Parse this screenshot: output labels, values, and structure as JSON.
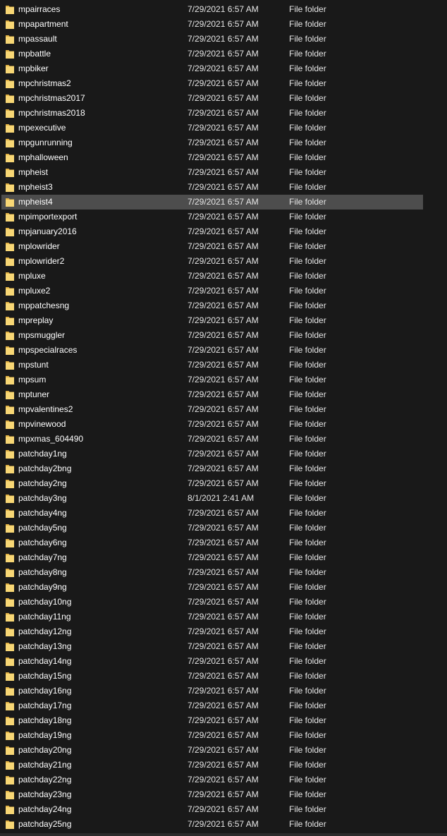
{
  "colors": {
    "background": "#191919",
    "selected_row": "#4d4d4d",
    "folder_icon": "#f8d775"
  },
  "icons": {
    "folder": "folder-icon"
  },
  "selected_index": 13,
  "rows": [
    {
      "name": "mpairraces",
      "date": "7/29/2021 6:57 AM",
      "type": "File folder"
    },
    {
      "name": "mpapartment",
      "date": "7/29/2021 6:57 AM",
      "type": "File folder"
    },
    {
      "name": "mpassault",
      "date": "7/29/2021 6:57 AM",
      "type": "File folder"
    },
    {
      "name": "mpbattle",
      "date": "7/29/2021 6:57 AM",
      "type": "File folder"
    },
    {
      "name": "mpbiker",
      "date": "7/29/2021 6:57 AM",
      "type": "File folder"
    },
    {
      "name": "mpchristmas2",
      "date": "7/29/2021 6:57 AM",
      "type": "File folder"
    },
    {
      "name": "mpchristmas2017",
      "date": "7/29/2021 6:57 AM",
      "type": "File folder"
    },
    {
      "name": "mpchristmas2018",
      "date": "7/29/2021 6:57 AM",
      "type": "File folder"
    },
    {
      "name": "mpexecutive",
      "date": "7/29/2021 6:57 AM",
      "type": "File folder"
    },
    {
      "name": "mpgunrunning",
      "date": "7/29/2021 6:57 AM",
      "type": "File folder"
    },
    {
      "name": "mphalloween",
      "date": "7/29/2021 6:57 AM",
      "type": "File folder"
    },
    {
      "name": "mpheist",
      "date": "7/29/2021 6:57 AM",
      "type": "File folder"
    },
    {
      "name": "mpheist3",
      "date": "7/29/2021 6:57 AM",
      "type": "File folder"
    },
    {
      "name": "mpheist4",
      "date": "7/29/2021 6:57 AM",
      "type": "File folder"
    },
    {
      "name": "mpimportexport",
      "date": "7/29/2021 6:57 AM",
      "type": "File folder"
    },
    {
      "name": "mpjanuary2016",
      "date": "7/29/2021 6:57 AM",
      "type": "File folder"
    },
    {
      "name": "mplowrider",
      "date": "7/29/2021 6:57 AM",
      "type": "File folder"
    },
    {
      "name": "mplowrider2",
      "date": "7/29/2021 6:57 AM",
      "type": "File folder"
    },
    {
      "name": "mpluxe",
      "date": "7/29/2021 6:57 AM",
      "type": "File folder"
    },
    {
      "name": "mpluxe2",
      "date": "7/29/2021 6:57 AM",
      "type": "File folder"
    },
    {
      "name": "mppatchesng",
      "date": "7/29/2021 6:57 AM",
      "type": "File folder"
    },
    {
      "name": "mpreplay",
      "date": "7/29/2021 6:57 AM",
      "type": "File folder"
    },
    {
      "name": "mpsmuggler",
      "date": "7/29/2021 6:57 AM",
      "type": "File folder"
    },
    {
      "name": "mpspecialraces",
      "date": "7/29/2021 6:57 AM",
      "type": "File folder"
    },
    {
      "name": "mpstunt",
      "date": "7/29/2021 6:57 AM",
      "type": "File folder"
    },
    {
      "name": "mpsum",
      "date": "7/29/2021 6:57 AM",
      "type": "File folder"
    },
    {
      "name": "mptuner",
      "date": "7/29/2021 6:57 AM",
      "type": "File folder"
    },
    {
      "name": "mpvalentines2",
      "date": "7/29/2021 6:57 AM",
      "type": "File folder"
    },
    {
      "name": "mpvinewood",
      "date": "7/29/2021 6:57 AM",
      "type": "File folder"
    },
    {
      "name": "mpxmas_604490",
      "date": "7/29/2021 6:57 AM",
      "type": "File folder"
    },
    {
      "name": "patchday1ng",
      "date": "7/29/2021 6:57 AM",
      "type": "File folder"
    },
    {
      "name": "patchday2bng",
      "date": "7/29/2021 6:57 AM",
      "type": "File folder"
    },
    {
      "name": "patchday2ng",
      "date": "7/29/2021 6:57 AM",
      "type": "File folder"
    },
    {
      "name": "patchday3ng",
      "date": "8/1/2021 2:41 AM",
      "type": "File folder"
    },
    {
      "name": "patchday4ng",
      "date": "7/29/2021 6:57 AM",
      "type": "File folder"
    },
    {
      "name": "patchday5ng",
      "date": "7/29/2021 6:57 AM",
      "type": "File folder"
    },
    {
      "name": "patchday6ng",
      "date": "7/29/2021 6:57 AM",
      "type": "File folder"
    },
    {
      "name": "patchday7ng",
      "date": "7/29/2021 6:57 AM",
      "type": "File folder"
    },
    {
      "name": "patchday8ng",
      "date": "7/29/2021 6:57 AM",
      "type": "File folder"
    },
    {
      "name": "patchday9ng",
      "date": "7/29/2021 6:57 AM",
      "type": "File folder"
    },
    {
      "name": "patchday10ng",
      "date": "7/29/2021 6:57 AM",
      "type": "File folder"
    },
    {
      "name": "patchday11ng",
      "date": "7/29/2021 6:57 AM",
      "type": "File folder"
    },
    {
      "name": "patchday12ng",
      "date": "7/29/2021 6:57 AM",
      "type": "File folder"
    },
    {
      "name": "patchday13ng",
      "date": "7/29/2021 6:57 AM",
      "type": "File folder"
    },
    {
      "name": "patchday14ng",
      "date": "7/29/2021 6:57 AM",
      "type": "File folder"
    },
    {
      "name": "patchday15ng",
      "date": "7/29/2021 6:57 AM",
      "type": "File folder"
    },
    {
      "name": "patchday16ng",
      "date": "7/29/2021 6:57 AM",
      "type": "File folder"
    },
    {
      "name": "patchday17ng",
      "date": "7/29/2021 6:57 AM",
      "type": "File folder"
    },
    {
      "name": "patchday18ng",
      "date": "7/29/2021 6:57 AM",
      "type": "File folder"
    },
    {
      "name": "patchday19ng",
      "date": "7/29/2021 6:57 AM",
      "type": "File folder"
    },
    {
      "name": "patchday20ng",
      "date": "7/29/2021 6:57 AM",
      "type": "File folder"
    },
    {
      "name": "patchday21ng",
      "date": "7/29/2021 6:57 AM",
      "type": "File folder"
    },
    {
      "name": "patchday22ng",
      "date": "7/29/2021 6:57 AM",
      "type": "File folder"
    },
    {
      "name": "patchday23ng",
      "date": "7/29/2021 6:57 AM",
      "type": "File folder"
    },
    {
      "name": "patchday24ng",
      "date": "7/29/2021 6:57 AM",
      "type": "File folder"
    },
    {
      "name": "patchday25ng",
      "date": "7/29/2021 6:57 AM",
      "type": "File folder"
    }
  ]
}
